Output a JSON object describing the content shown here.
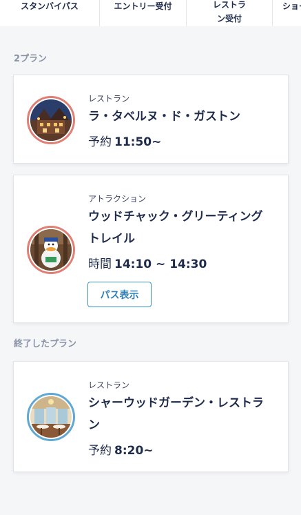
{
  "tabs": [
    {
      "label": "スタンバイパス"
    },
    {
      "label": "エントリー受付"
    },
    {
      "label": "レストラン受付"
    },
    {
      "label": "ショー"
    }
  ],
  "sections": {
    "current": "2プラン",
    "finished": "終了したプラン"
  },
  "cards": [
    {
      "category": "レストラン",
      "name": "ラ・タベルヌ・ド・ガストン",
      "time_prefix": "予約",
      "time_value": "11:50~",
      "image_icon": "restaurant-exterior-photo"
    },
    {
      "category": "アトラクション",
      "name": "ウッドチャック・グリーティングトレイル",
      "time_prefix": "時間",
      "time_value": "14:10 ~ 14:30",
      "button_label": "パス表示",
      "image_icon": "donald-duck-photo"
    },
    {
      "category": "レストラン",
      "name": "シャーウッドガーデン・レストラン",
      "time_prefix": "予約",
      "time_value": "8:20~",
      "image_icon": "restaurant-interior-photo"
    }
  ],
  "colors": {
    "ring_active": "#e07f74",
    "ring_finished": "#5fa8d3",
    "button_border": "#3a8fc4"
  }
}
